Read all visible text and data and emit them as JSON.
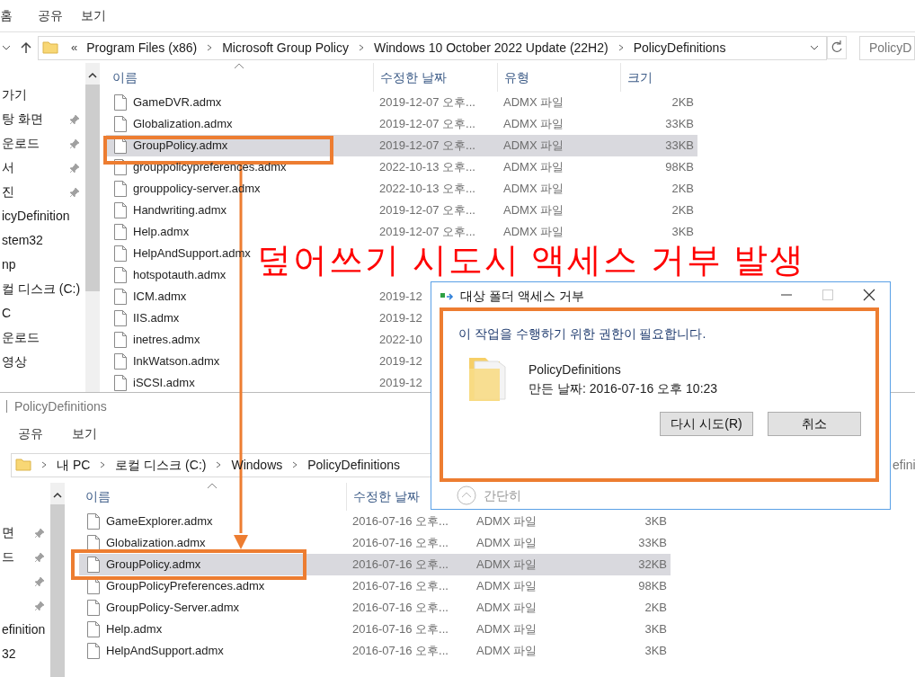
{
  "top_window": {
    "ribbon_tabs": [
      "홈",
      "공유",
      "보기"
    ],
    "address": {
      "prefix": "«",
      "crumbs": [
        "Program Files (x86)",
        "Microsoft Group Policy",
        "Windows 10 October 2022 Update (22H2)",
        "PolicyDefinitions"
      ]
    },
    "search": {
      "placeholder": "PolicyD"
    },
    "sidebar": [
      {
        "label": "가기",
        "pinned": false
      },
      {
        "label": "탕 화면",
        "pinned": true
      },
      {
        "label": "운로드",
        "pinned": true
      },
      {
        "label": "서",
        "pinned": true
      },
      {
        "label": "진",
        "pinned": true
      },
      {
        "label": "icyDefinition",
        "pinned": false
      },
      {
        "label": "stem32",
        "pinned": false
      },
      {
        "label": "np",
        "pinned": false
      },
      {
        "label": "컬 디스크 (C:)",
        "pinned": false
      },
      {
        "label": "C",
        "pinned": false
      },
      {
        "label": "운로드",
        "pinned": false
      },
      {
        "label": "영상",
        "pinned": false
      }
    ],
    "columns": [
      "이름",
      "수정한 날짜",
      "유형",
      "크기"
    ],
    "rows": [
      {
        "name": "GameDVR.admx",
        "date": "2019-12-07 오후...",
        "type": "ADMX 파일",
        "size": "2KB",
        "selected": false
      },
      {
        "name": "Globalization.admx",
        "date": "2019-12-07 오후...",
        "type": "ADMX 파일",
        "size": "33KB",
        "selected": false
      },
      {
        "name": "GroupPolicy.admx",
        "date": "2019-12-07 오후...",
        "type": "ADMX 파일",
        "size": "33KB",
        "selected": true
      },
      {
        "name": "grouppolicypreferences.admx",
        "date": "2022-10-13 오후...",
        "type": "ADMX 파일",
        "size": "98KB",
        "selected": false
      },
      {
        "name": "grouppolicy-server.admx",
        "date": "2022-10-13 오후...",
        "type": "ADMX 파일",
        "size": "2KB",
        "selected": false
      },
      {
        "name": "Handwriting.admx",
        "date": "2019-12-07 오후...",
        "type": "ADMX 파일",
        "size": "2KB",
        "selected": false
      },
      {
        "name": "Help.admx",
        "date": "2019-12-07 오후...",
        "type": "ADMX 파일",
        "size": "3KB",
        "selected": false
      },
      {
        "name": "HelpAndSupport.admx",
        "selected": false
      },
      {
        "name": "hotspotauth.admx",
        "selected": false
      },
      {
        "name": "ICM.admx",
        "date": "2019-12",
        "selected": false
      },
      {
        "name": "IIS.admx",
        "date": "2019-12",
        "selected": false
      },
      {
        "name": "inetres.admx",
        "date": "2022-10",
        "selected": false
      },
      {
        "name": "InkWatson.admx",
        "date": "2019-12",
        "selected": false
      },
      {
        "name": "iSCSI.admx",
        "date": "2019-12",
        "selected": false
      }
    ]
  },
  "bottom_window": {
    "title": "PolicyDefinitions",
    "ribbon_tabs": [
      "공유",
      "보기"
    ],
    "address": {
      "crumbs": [
        "내 PC",
        "로컬 디스크 (C:)",
        "Windows",
        "PolicyDefinitions"
      ]
    },
    "search": {
      "placeholder": "efini"
    },
    "sidebar": [
      {
        "label": "면",
        "pinned": true
      },
      {
        "label": "드",
        "pinned": true
      },
      {
        "pinned": true
      },
      {
        "pinned": true
      },
      {
        "label": "efinition",
        "pinned": false
      },
      {
        "label": "32",
        "pinned": false
      }
    ],
    "columns": [
      "이름",
      "수정한 날짜"
    ],
    "rows": [
      {
        "name": "GameExplorer.admx",
        "date": "2016-07-16 오후...",
        "type": "ADMX 파일",
        "size": "3KB",
        "selected": false
      },
      {
        "name": "Globalization.admx",
        "date": "2016-07-16 오후...",
        "type": "ADMX 파일",
        "size": "33KB",
        "selected": false
      },
      {
        "name": "GroupPolicy.admx",
        "date": "2016-07-16 오후...",
        "type": "ADMX 파일",
        "size": "32KB",
        "selected": true
      },
      {
        "name": "GroupPolicyPreferences.admx",
        "date": "2016-07-16 오후...",
        "type": "ADMX 파일",
        "size": "98KB",
        "selected": false
      },
      {
        "name": "GroupPolicy-Server.admx",
        "date": "2016-07-16 오후...",
        "type": "ADMX 파일",
        "size": "2KB",
        "selected": false
      },
      {
        "name": "Help.admx",
        "date": "2016-07-16 오후...",
        "type": "ADMX 파일",
        "size": "3KB",
        "selected": false
      },
      {
        "name": "HelpAndSupport.admx",
        "date": "2016-07-16 오후...",
        "type": "ADMX 파일",
        "size": "3KB",
        "selected": false
      }
    ]
  },
  "dialog": {
    "title": "대상 폴더 액세스 거부",
    "message": "이 작업을 수행하기 위한 권한이 필요합니다.",
    "item_name": "PolicyDefinitions",
    "item_created": "만든 날짜: 2016-07-16 오후 10:23",
    "buttons": [
      "다시 시도(R)",
      "취소"
    ],
    "details_toggle": "간단히"
  },
  "annotation": {
    "text": "덮어쓰기 시도시 액세스 거부 발생"
  }
}
